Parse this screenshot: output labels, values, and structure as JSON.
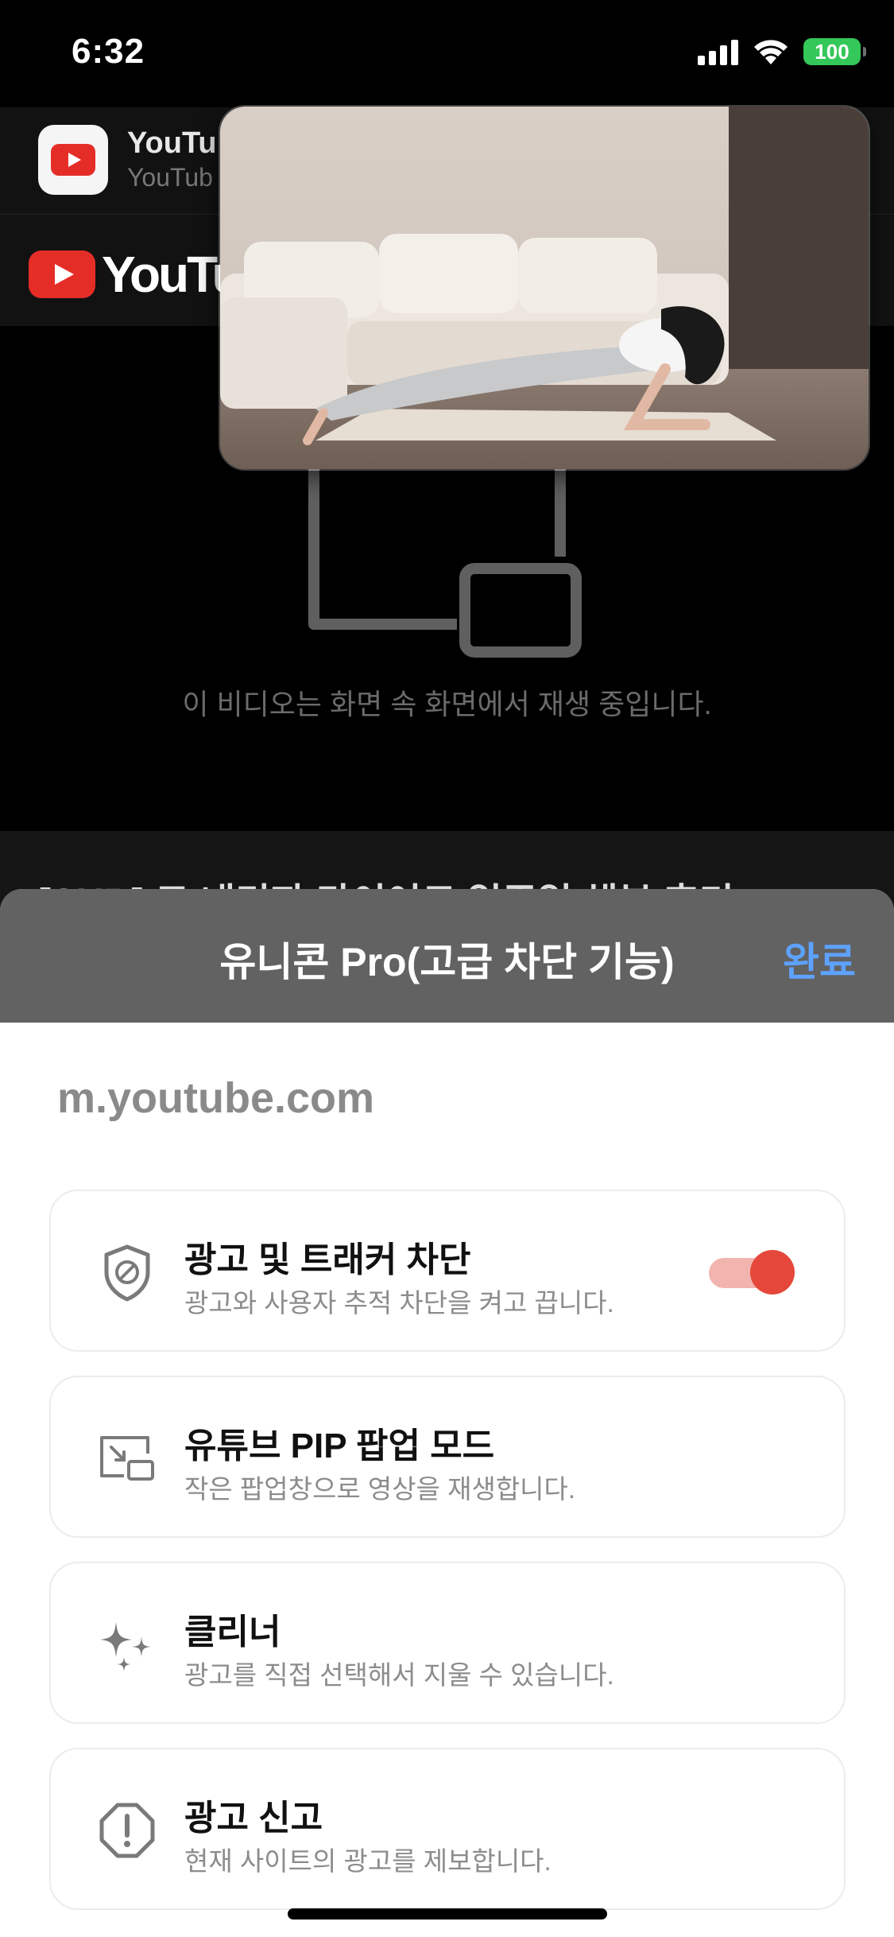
{
  "status_bar": {
    "time": "6:32",
    "battery": "100"
  },
  "app_banner": {
    "name": "YouTu",
    "subtitle": "YouTub"
  },
  "youtube_header": {
    "logo_text": "YouTub"
  },
  "pip_notice": {
    "message": "이 비디오는 화면 속 화면에서 재생 중입니다."
  },
  "video_title": {
    "text": "[SUB] 코 내리자 다이어트 일주일 해본 후기"
  },
  "sheet": {
    "title": "유니콘 Pro(고급 차단 기능)",
    "done_label": "완료",
    "domain": "m.youtube.com",
    "options": [
      {
        "title": "광고 및 트래커 차단",
        "description": "광고와 사용자 추적 차단을 켜고 끕니다.",
        "icon": "shield-block-icon",
        "toggle_on": true
      },
      {
        "title": "유튜브 PIP 팝업 모드",
        "description": "작은 팝업창으로 영상을 재생합니다.",
        "icon": "pip-icon"
      },
      {
        "title": "클리너",
        "description": "광고를 직접 선택해서 지울 수 있습니다.",
        "icon": "sparkles-icon"
      },
      {
        "title": "광고 신고",
        "description": "현재 사이트의 광고를 제보합니다.",
        "icon": "report-icon"
      }
    ]
  },
  "colors": {
    "toggle_accent": "#e5473a",
    "done_link": "#5ea2ff",
    "sheet_header": "#626262",
    "battery": "#34c759"
  }
}
